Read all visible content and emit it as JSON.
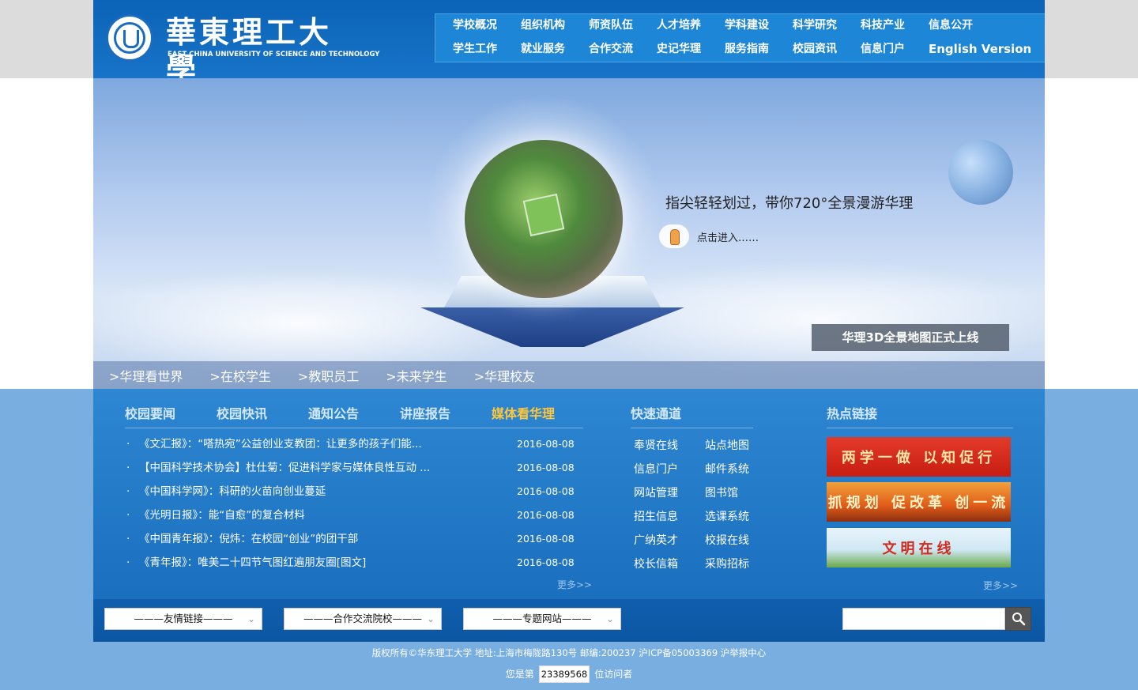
{
  "logo": {
    "name_cn": "華東理工大學",
    "name_en": "EAST CHINA UNIVERSITY OF SCIENCE AND TECHNOLOGY"
  },
  "nav": {
    "row1": [
      "学校概况",
      "组织机构",
      "师资队伍",
      "人才培养",
      "学科建设",
      "科学研究",
      "科技产业",
      "信息公开"
    ],
    "row2": [
      "学生工作",
      "就业服务",
      "合作交流",
      "史记华理",
      "服务指南",
      "校园资讯",
      "信息门户",
      "English Version"
    ]
  },
  "banner": {
    "promo_text": "指尖轻轻划过，带你720°全景漫游华理",
    "enter_text": "点击进入……",
    "caption": "华理3D全景地图正式上线",
    "tabs": [
      ">华理看世界",
      ">在校学生",
      ">教职员工",
      ">未来学生",
      ">华理校友"
    ]
  },
  "news": {
    "tabs": [
      "校园要闻",
      "校园快讯",
      "通知公告",
      "讲座报告",
      "媒体看华理"
    ],
    "active_tab": "媒体看华理",
    "items": [
      {
        "bullet": "·",
        "title": "《文汇报》：“嗒热宛”公益创业支教团：让更多的孩子们能...",
        "date": "2016-08-08"
      },
      {
        "bullet": "·",
        "title": "【中国科学技术协会】杜仕菊：促进科学家与媒体良性互动 ...",
        "date": "2016-08-08"
      },
      {
        "bullet": "·",
        "title": "《中国科学网》：科研的火苗向创业蔓延",
        "date": "2016-08-08"
      },
      {
        "bullet": "·",
        "title": "《光明日报》：能“自愈”的复合材料",
        "date": "2016-08-08"
      },
      {
        "bullet": "·",
        "title": "《中国青年报》：倪炜：在校园“创业”的团干部",
        "date": "2016-08-08"
      },
      {
        "bullet": "·",
        "title": "《青年报》：唯美二十四节气图红遍朋友圈[图文]",
        "date": "2016-08-08"
      }
    ],
    "more": "更多>>"
  },
  "quick": {
    "title": "快速通道",
    "links": [
      "奉贤在线",
      "站点地图",
      "信息门户",
      "邮件系统",
      "网站管理",
      "图书馆",
      "招生信息",
      "选课系统",
      "广纳英才",
      "校报在线",
      "校长信箱",
      "采购招标"
    ]
  },
  "hot": {
    "title": "热点链接",
    "banners": [
      "两学一做 以知促行",
      "抓规划 促改革 创一流",
      "文明在线"
    ],
    "more": "更多>>"
  },
  "bottom": {
    "selects": [
      "———友情链接———",
      "———合作交流院校———",
      "———专题网站———"
    ],
    "search_value": ""
  },
  "footer": {
    "copyright": "版权所有©华东理工大学  地址:上海市梅陇路130号  邮编:200237  沪ICP备05003369  沪举报中心",
    "visits_prefix": "您是第",
    "visits_count": "23389568",
    "visits_suffix": "位访问者"
  },
  "colors": {
    "header_blue": "#0c63b7",
    "nav_blue": "#1d86d6",
    "content_blue": "#1a6fbe",
    "active_tab": "#ffc83a",
    "page_bg": "#78aee0"
  }
}
